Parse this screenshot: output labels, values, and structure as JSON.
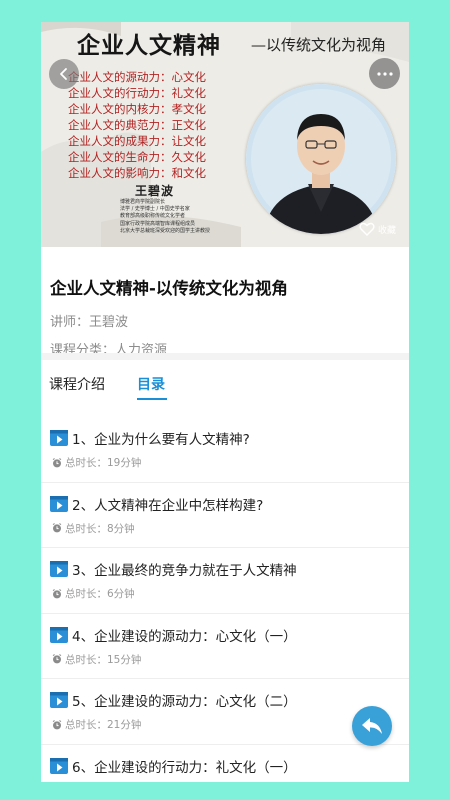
{
  "banner": {
    "title": "企业人文精神",
    "subtitle": "—以传统文化为视角",
    "verses": [
      "企业人文的源动力：心文化",
      "企业人文的行动力：礼文化",
      "企业人文的内核力：孝文化",
      "企业人文的典范力：正文化",
      "企业人文的成果力：让文化",
      "企业人文的生命力：久文化",
      "企业人文的影响力：和文化"
    ],
    "speaker_name": "王碧波",
    "speaker_bio": [
      "博雅君商学院副院长",
      "法学 / 史学博士 / 中国史学名家",
      "教育部高级职称传统文化学者",
      "国家行政学院高端智库课程组成员",
      "北京大学总裁班深受欢迎的国学主讲教授"
    ]
  },
  "favorite_label": "收藏",
  "course": {
    "title": "企业人文精神-以传统文化为视角",
    "lecturer": "讲师：王碧波",
    "category": "课程分类：人力资源"
  },
  "tabs": {
    "intro": "课程介绍",
    "toc": "目录"
  },
  "lessons": [
    {
      "title": "1、企业为什么要有人文精神?",
      "duration": "总时长：19分钟"
    },
    {
      "title": "2、人文精神在企业中怎样构建?",
      "duration": "总时长：8分钟"
    },
    {
      "title": "3、企业最终的竞争力就在于人文精神",
      "duration": "总时长：6分钟"
    },
    {
      "title": "4、企业建设的源动力：心文化（一）",
      "duration": "总时长：15分钟"
    },
    {
      "title": "5、企业建设的源动力：心文化（二）",
      "duration": "总时长：21分钟"
    },
    {
      "title": "6、企业建设的行动力：礼文化（一）",
      "duration": ""
    }
  ],
  "colors": {
    "page_bg": "#7ff0d9",
    "accent": "#1a8fd8",
    "verse_red": "#b22323",
    "video_icon": "#2a8fd6"
  },
  "icons": {
    "back": "chevron-left-icon",
    "more": "more-icon",
    "favorite": "heart-icon",
    "lesson": "video-icon",
    "duration": "clock-icon",
    "share": "share-icon"
  }
}
